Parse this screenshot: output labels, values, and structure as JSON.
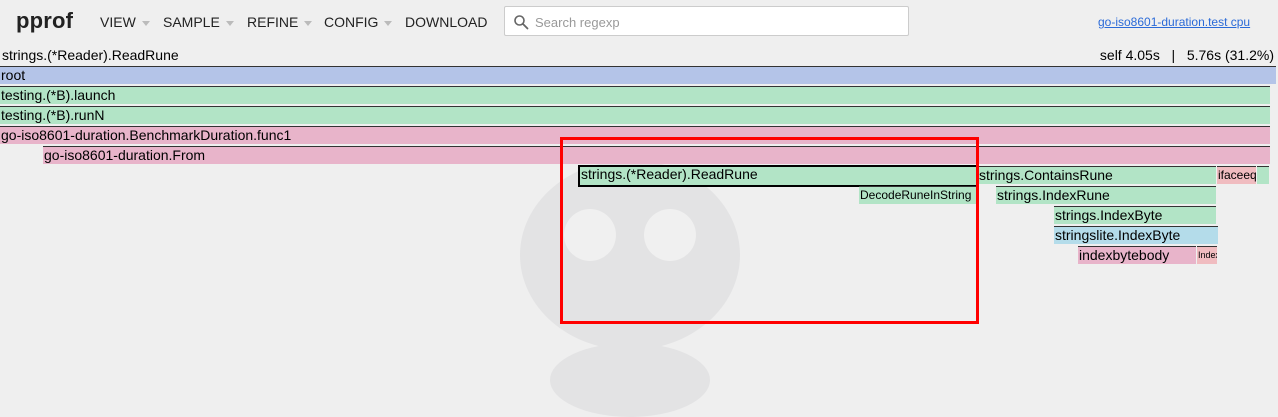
{
  "header": {
    "logo": "pprof",
    "menus": [
      {
        "label": "VIEW",
        "caret": true
      },
      {
        "label": "SAMPLE",
        "caret": true
      },
      {
        "label": "REFINE",
        "caret": true
      },
      {
        "label": "CONFIG",
        "caret": true
      },
      {
        "label": "DOWNLOAD",
        "caret": false
      }
    ],
    "search": {
      "placeholder": "Search regexp",
      "value": "",
      "icon": "search-icon"
    },
    "profile_link": "go-iso8601-duration.test cpu"
  },
  "detail": {
    "name": "strings.(*Reader).ReadRune",
    "self_label": "self 4.05s",
    "separator": "|",
    "total_label": "5.76s (31.2%)"
  },
  "flame": {
    "frames": [
      {
        "label": "root",
        "color": "#b4c4e8",
        "selected": false
      },
      {
        "label": "testing.(*B).launch",
        "color": "#b2e4c6",
        "selected": false
      },
      {
        "label": "testing.(*B).runN",
        "color": "#b2e4c6",
        "selected": false
      },
      {
        "label": "go-iso8601-duration.BenchmarkDuration.func1",
        "color": "#e8b4ca",
        "selected": false
      },
      {
        "label": "go-iso8601-duration.From",
        "color": "#e8b4ca",
        "selected": false
      },
      {
        "label": "strings.(*Reader).ReadRune",
        "color": "#b2e4c6",
        "selected": true
      },
      {
        "label": "strings.ContainsRune",
        "color": "#b2e4c6",
        "selected": false
      },
      {
        "label": "ifaceeq",
        "color": "#f0bcc0",
        "selected": false
      },
      {
        "label": "",
        "color": "#b2e4c6",
        "selected": false
      },
      {
        "label": "DecodeRuneInString",
        "color": "#b2e4c6",
        "selected": false
      },
      {
        "label": "strings.IndexRune",
        "color": "#b2e4c6",
        "selected": false
      },
      {
        "label": "strings.IndexByte",
        "color": "#b2e4c6",
        "selected": false
      },
      {
        "label": "stringslite.IndexByte",
        "color": "#b4dcea",
        "selected": false
      },
      {
        "label": "indexbytebody",
        "color": "#e8b4ca",
        "selected": false
      },
      {
        "label": "IndexByte",
        "color": "#e8b4ca",
        "selected": false
      }
    ]
  }
}
